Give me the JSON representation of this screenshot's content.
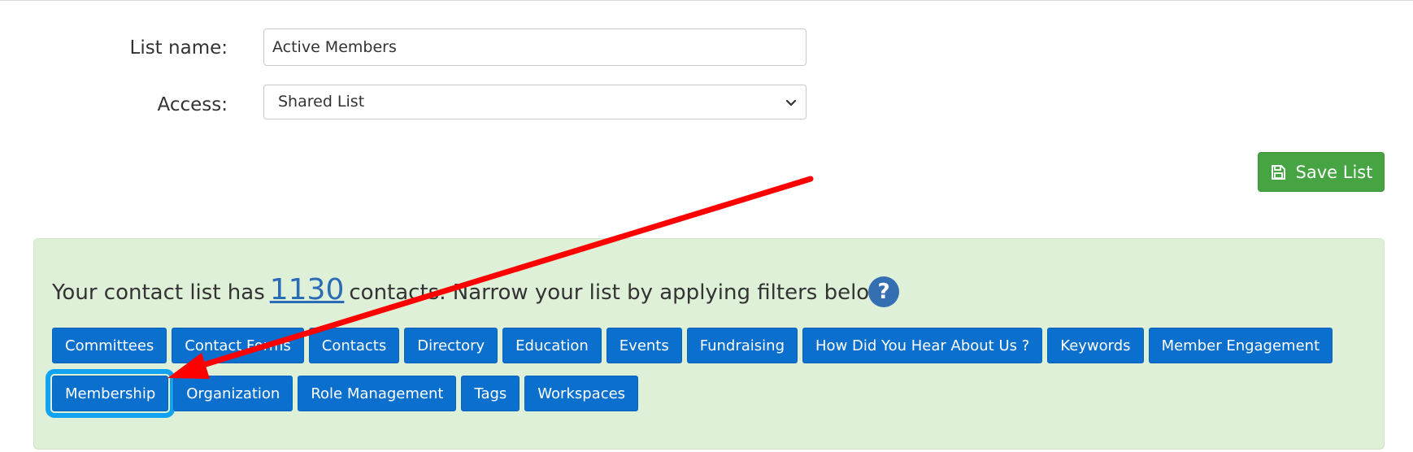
{
  "form": {
    "list_name_label": "List name:",
    "list_name_value": "Active Members",
    "access_label": "Access:",
    "access_value": "Shared List"
  },
  "actions": {
    "save_label": "Save List"
  },
  "summary": {
    "prefix": "Your contact list has",
    "count": "1130",
    "suffix": "contacts. Narrow your list by applying filters below:",
    "help_symbol": "?"
  },
  "filters": {
    "row1": [
      "Committees",
      "Contact Forms",
      "Contacts",
      "Directory",
      "Education",
      "Events",
      "Fundraising",
      "How Did You Hear About Us ?",
      "Keywords",
      "Member Engagement"
    ],
    "row2": [
      "Membership",
      "Organization",
      "Role Management",
      "Tags",
      "Workspaces"
    ],
    "highlighted": "Membership"
  },
  "colors": {
    "primary_button": "#0b6fce",
    "success_button": "#46a443",
    "panel_background": "#dff0d8",
    "highlight_outline": "#12a2f2",
    "annotation_arrow": "#ff0000"
  }
}
